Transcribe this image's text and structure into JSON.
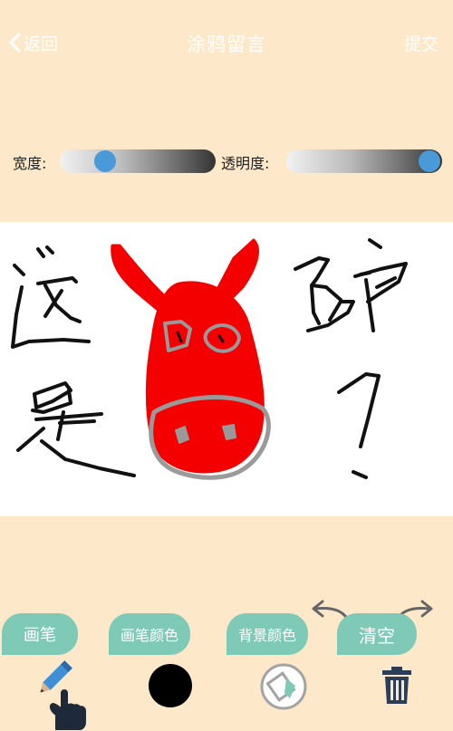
{
  "nav": {
    "back_label": "返回",
    "title": "涂鸦留言",
    "submit_label": "提交"
  },
  "sliders": {
    "width": {
      "label": "宽度:",
      "value": 0.25
    },
    "opacity": {
      "label": "透明度:",
      "value": 1.0
    }
  },
  "toolbar": {
    "pen_label": "画笔",
    "pen_color_label": "画笔颜色",
    "bg_color_label": "背景颜色",
    "clear_label": "清空"
  },
  "colors": {
    "page_bg": "#fde9c9",
    "accent": "#7ecab7",
    "slider_thumb": "#4a9ad9",
    "pen_color": "#000000",
    "drawing_red": "#f40000",
    "trash_icon": "#2c3e55"
  },
  "icons": {
    "back": "chevron-left-icon",
    "undo": "undo-arrow-icon",
    "redo": "redo-arrow-icon",
    "pen": "pencil-icon",
    "bg": "paint-bucket-icon",
    "trash": "trash-icon"
  }
}
